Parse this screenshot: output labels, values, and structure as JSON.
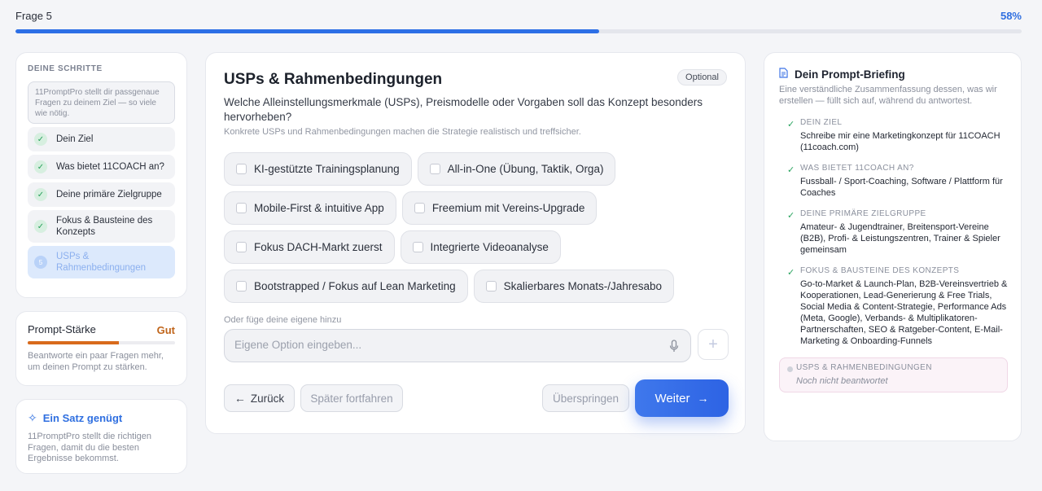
{
  "progress": {
    "label": "Frage 5",
    "percent_text": "58%",
    "value": 0.58
  },
  "steps": {
    "title": "DEINE SCHRITTE",
    "note": "11PromptPro stellt dir passgenaue Fragen zu deinem Ziel — so viele wie nötig.",
    "items": [
      {
        "label": "Dein Ziel",
        "state": "done"
      },
      {
        "label": "Was bietet 11COACH an?",
        "state": "done"
      },
      {
        "label": "Deine primäre Zielgruppe",
        "state": "done"
      },
      {
        "label": "Fokus & Bausteine des Konzepts",
        "state": "done"
      },
      {
        "label": "USPs & Rahmenbedingungen",
        "state": "active"
      }
    ],
    "active_number": "5"
  },
  "strength": {
    "title": "Prompt-Stärke",
    "level": "Gut",
    "value": 0.62,
    "hint": "Beantworte ein paar Fragen mehr, um deinen Prompt zu stärken."
  },
  "tip": {
    "icon": "sparkle-icon",
    "title": "Ein Satz genügt",
    "text": "11PromptPro stellt die richtigen Fragen, damit du die besten Ergebnisse bekommst."
  },
  "main": {
    "title": "USPs & Rahmenbedingungen",
    "badge": "Optional",
    "question": "Welche Alleinstellungsmerkmale (USPs), Preismodelle oder Vorgaben soll das Konzept besonders hervorheben?",
    "hint": "Konkrete USPs und Rahmenbedingungen machen die Strategie realistisch und treffsicher.",
    "options": [
      [
        "KI-gestützte Trainingsplanung",
        "All-in-One (Übung, Taktik, Orga)"
      ],
      [
        "Mobile-First & intuitive App",
        "Freemium mit Vereins-Upgrade"
      ],
      [
        "Fokus DACH-Markt zuerst",
        "Integrierte Videoanalyse"
      ],
      [
        "Bootstrapped / Fokus auf Lean Marketing",
        "Skalierbares Monats-/Jahresabo"
      ]
    ],
    "own_label": "Oder füge deine eigene hinzu",
    "own_placeholder": "Eigene Option eingeben...",
    "buttons": {
      "back": "Zurück",
      "later": "Später fortfahren",
      "skip": "Überspringen",
      "next": "Weiter"
    }
  },
  "briefing": {
    "title": "Dein Prompt-Briefing",
    "subtitle": "Eine verständliche Zusammenfassung dessen, was wir erstellen — füllt sich auf, während du antwortest.",
    "items": [
      {
        "key": "DEIN ZIEL",
        "value": "Schreibe mir eine Marketingkonzept für 11COACH (11coach.com)"
      },
      {
        "key": "WAS BIETET 11COACH AN?",
        "value": "Fussball- / Sport-Coaching, Software / Plattform für Coaches"
      },
      {
        "key": "DEINE PRIMÄRE ZIELGRUPPE",
        "value": "Amateur- & Jugendtrainer, Breitensport-Vereine (B2B), Profi- & Leistungszentren, Trainer & Spieler gemeinsam"
      },
      {
        "key": "FOKUS & BAUSTEINE DES KONZEPTS",
        "value": "Go-to-Market & Launch-Plan, B2B-Vereinsvertrieb & Kooperationen, Lead-Generierung & Free Trials, Social Media & Content-Strategie, Performance Ads (Meta, Google), Verbands- & Multiplikatoren-Partnerschaften, SEO & Ratgeber-Content, E-Mail-Marketing & Onboarding-Funnels"
      }
    ],
    "pending": {
      "key": "USPS & RAHMENBEDINGUNGEN",
      "value": "Noch nicht beantwortet"
    }
  }
}
